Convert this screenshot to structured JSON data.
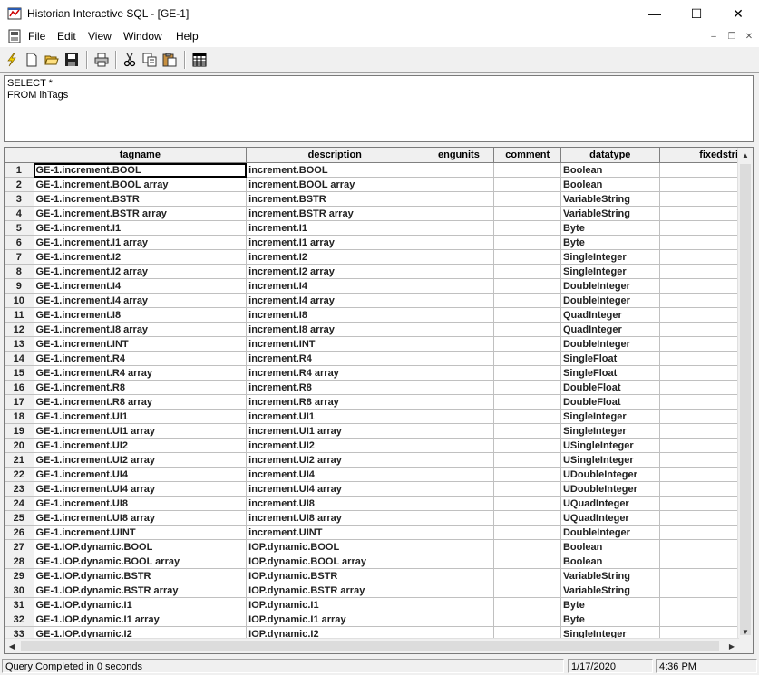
{
  "window": {
    "title": "Historian Interactive SQL - [GE-1]",
    "minimize": "—",
    "maximize": "☐",
    "close": "✕"
  },
  "menu": {
    "items": [
      "File",
      "Edit",
      "View",
      "Window",
      "Help"
    ],
    "mdi_minimize": "–",
    "mdi_restore": "❐",
    "mdi_close": "✕"
  },
  "toolbar": {
    "buttons": [
      "execute-icon",
      "new-icon",
      "open-icon",
      "save-icon",
      "print-icon",
      "cut-icon",
      "copy-icon",
      "paste-icon",
      "grid-icon"
    ]
  },
  "query": {
    "text": "SELECT *\nFROM ihTags"
  },
  "grid": {
    "columns": [
      "tagname",
      "description",
      "engunits",
      "comment",
      "datatype",
      "fixedstri"
    ],
    "rows": [
      [
        "1",
        "GE-1.increment.BOOL",
        "increment.BOOL",
        "",
        "",
        "Boolean",
        ""
      ],
      [
        "2",
        "GE-1.increment.BOOL array",
        "increment.BOOL array",
        "",
        "",
        "Boolean",
        ""
      ],
      [
        "3",
        "GE-1.increment.BSTR",
        "increment.BSTR",
        "",
        "",
        "VariableString",
        ""
      ],
      [
        "4",
        "GE-1.increment.BSTR array",
        "increment.BSTR array",
        "",
        "",
        "VariableString",
        ""
      ],
      [
        "5",
        "GE-1.increment.I1",
        "increment.I1",
        "",
        "",
        "Byte",
        ""
      ],
      [
        "6",
        "GE-1.increment.I1 array",
        "increment.I1 array",
        "",
        "",
        "Byte",
        ""
      ],
      [
        "7",
        "GE-1.increment.I2",
        "increment.I2",
        "",
        "",
        "SingleInteger",
        ""
      ],
      [
        "8",
        "GE-1.increment.I2 array",
        "increment.I2 array",
        "",
        "",
        "SingleInteger",
        ""
      ],
      [
        "9",
        "GE-1.increment.I4",
        "increment.I4",
        "",
        "",
        "DoubleInteger",
        ""
      ],
      [
        "10",
        "GE-1.increment.I4 array",
        "increment.I4 array",
        "",
        "",
        "DoubleInteger",
        ""
      ],
      [
        "11",
        "GE-1.increment.I8",
        "increment.I8",
        "",
        "",
        "QuadInteger",
        ""
      ],
      [
        "12",
        "GE-1.increment.I8 array",
        "increment.I8 array",
        "",
        "",
        "QuadInteger",
        ""
      ],
      [
        "13",
        "GE-1.increment.INT",
        "increment.INT",
        "",
        "",
        "DoubleInteger",
        ""
      ],
      [
        "14",
        "GE-1.increment.R4",
        "increment.R4",
        "",
        "",
        "SingleFloat",
        ""
      ],
      [
        "15",
        "GE-1.increment.R4 array",
        "increment.R4 array",
        "",
        "",
        "SingleFloat",
        ""
      ],
      [
        "16",
        "GE-1.increment.R8",
        "increment.R8",
        "",
        "",
        "DoubleFloat",
        ""
      ],
      [
        "17",
        "GE-1.increment.R8 array",
        "increment.R8 array",
        "",
        "",
        "DoubleFloat",
        ""
      ],
      [
        "18",
        "GE-1.increment.UI1",
        "increment.UI1",
        "",
        "",
        "SingleInteger",
        ""
      ],
      [
        "19",
        "GE-1.increment.UI1 array",
        "increment.UI1 array",
        "",
        "",
        "SingleInteger",
        ""
      ],
      [
        "20",
        "GE-1.increment.UI2",
        "increment.UI2",
        "",
        "",
        "USingleInteger",
        ""
      ],
      [
        "21",
        "GE-1.increment.UI2 array",
        "increment.UI2 array",
        "",
        "",
        "USingleInteger",
        ""
      ],
      [
        "22",
        "GE-1.increment.UI4",
        "increment.UI4",
        "",
        "",
        "UDoubleInteger",
        ""
      ],
      [
        "23",
        "GE-1.increment.UI4 array",
        "increment.UI4 array",
        "",
        "",
        "UDoubleInteger",
        ""
      ],
      [
        "24",
        "GE-1.increment.UI8",
        "increment.UI8",
        "",
        "",
        "UQuadInteger",
        ""
      ],
      [
        "25",
        "GE-1.increment.UI8 array",
        "increment.UI8 array",
        "",
        "",
        "UQuadInteger",
        ""
      ],
      [
        "26",
        "GE-1.increment.UINT",
        "increment.UINT",
        "",
        "",
        "DoubleInteger",
        ""
      ],
      [
        "27",
        "GE-1.IOP.dynamic.BOOL",
        "IOP.dynamic.BOOL",
        "",
        "",
        "Boolean",
        ""
      ],
      [
        "28",
        "GE-1.IOP.dynamic.BOOL array",
        "IOP.dynamic.BOOL array",
        "",
        "",
        "Boolean",
        ""
      ],
      [
        "29",
        "GE-1.IOP.dynamic.BSTR",
        "IOP.dynamic.BSTR",
        "",
        "",
        "VariableString",
        ""
      ],
      [
        "30",
        "GE-1.IOP.dynamic.BSTR array",
        "IOP.dynamic.BSTR array",
        "",
        "",
        "VariableString",
        ""
      ],
      [
        "31",
        "GE-1.IOP.dynamic.I1",
        "IOP.dynamic.I1",
        "",
        "",
        "Byte",
        ""
      ],
      [
        "32",
        "GE-1.IOP.dynamic.I1 array",
        "IOP.dynamic.I1 array",
        "",
        "",
        "Byte",
        ""
      ],
      [
        "33",
        "GE-1.IOP.dynamic.I2",
        "IOP.dynamic.I2",
        "",
        "",
        "SingleInteger",
        ""
      ]
    ]
  },
  "status": {
    "message": "Query Completed in  0 seconds",
    "date": "1/17/2020",
    "time": "4:36 PM"
  }
}
